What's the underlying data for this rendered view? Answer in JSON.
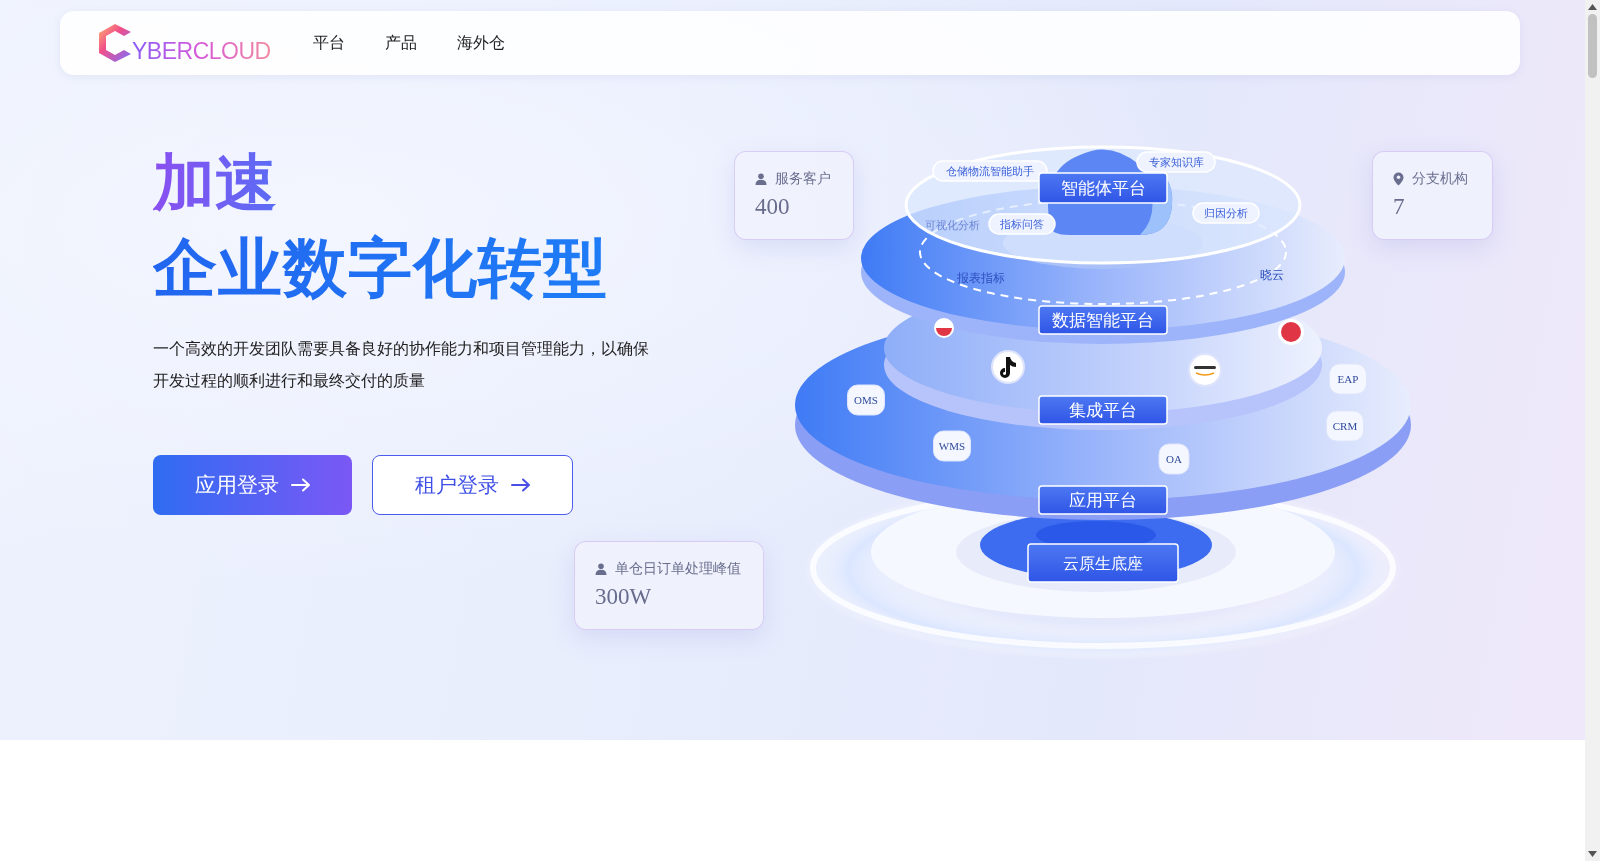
{
  "header": {
    "logo": "YBERCLOUD",
    "nav": [
      "平台",
      "产品",
      "海外仓"
    ]
  },
  "hero": {
    "kicker": "加速",
    "title": "企业数字化转型",
    "description": "一个高效的开发团队需要具备良好的协作能力和项目管理能力，以确保开发过程的顺利进行和最终交付的质量",
    "buttons": [
      {
        "label": "应用登录",
        "kind": "primary"
      },
      {
        "label": "租户登录",
        "kind": "outline"
      }
    ]
  },
  "stats": [
    {
      "kind": "person",
      "label": "服务客户",
      "value": "400"
    },
    {
      "kind": "pin",
      "label": "分支机构",
      "value": "7"
    },
    {
      "kind": "person",
      "label": "单仓日订单处理峰值",
      "value": "300W"
    }
  ],
  "diagram": {
    "layers": [
      "智能体平台",
      "数据智能平台",
      "集成平台",
      "应用平台",
      "云原生底座"
    ],
    "tags": [
      {
        "text": "仓储物流智能助手",
        "kind": "pill"
      },
      {
        "text": "专家知识库",
        "kind": "pill"
      },
      {
        "text": "可视化分析",
        "kind": "faint"
      },
      {
        "text": "指标问答",
        "kind": "pill"
      },
      {
        "text": "归因分析",
        "kind": "pill"
      },
      {
        "text": "报表指标",
        "kind": "plain"
      },
      {
        "text": "晓云",
        "kind": "plain"
      }
    ],
    "systems": [
      "OMS",
      "WMS",
      "OA",
      "EAP",
      "CRM"
    ]
  }
}
